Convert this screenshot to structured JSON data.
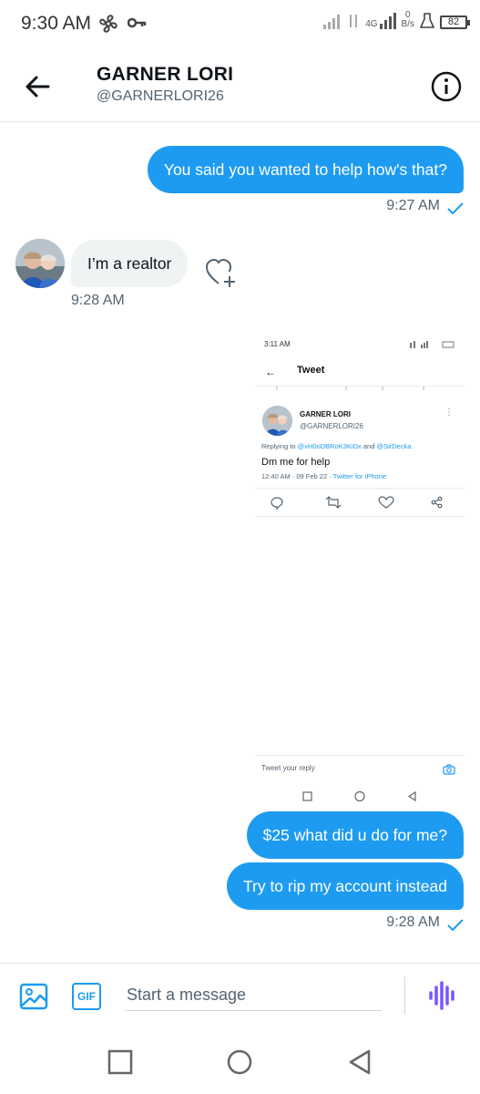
{
  "status_bar": {
    "time": "9:30 AM",
    "network": "4G",
    "speed_value": "0",
    "speed_unit": "B/s",
    "battery": "82",
    "icons": [
      "fan-icon",
      "key-icon",
      "signal-icon",
      "battery-icon"
    ]
  },
  "header": {
    "name": "GARNER LORI",
    "handle": "@GARNERLORI26",
    "icons": [
      "back-arrow-icon",
      "info-icon"
    ]
  },
  "messages": [
    {
      "direction": "out",
      "text": "You said you wanted to help how's that?",
      "time": "9:27 AM"
    },
    {
      "direction": "in",
      "text": "I’m a realtor",
      "time": "9:28 AM"
    },
    {
      "direction": "out",
      "type": "image",
      "description": "embedded-tweet-screenshot"
    },
    {
      "direction": "out",
      "text": "$25 what did u do for me?"
    },
    {
      "direction": "out",
      "text": "Try to rip my account instead",
      "time": "9:28 AM"
    }
  ],
  "embedded_screenshot": {
    "status_time": "3:11 AM",
    "title": "Tweet",
    "name": "GARNER LORI",
    "handle": "@GARNERLORI26",
    "replying_prefix": "Replying to",
    "replying_user1": "@xH0oDBRoK3KiDx",
    "replying_and": "and",
    "replying_user2": "@SirDecka",
    "tweet_text": "Dm me for help",
    "meta_time": "12:40 AM · 09 Feb 22 ·",
    "meta_source": "Twitter for iPhone",
    "compose_placeholder": "Tweet your reply"
  },
  "composer": {
    "placeholder": "Start a message",
    "gif_label": "GIF",
    "icons": [
      "image-icon",
      "gif-icon",
      "voice-icon"
    ]
  },
  "colors": {
    "accent": "#1d9bf0",
    "voice": "#7856ff",
    "incoming_bubble": "#eff3f4",
    "muted_text": "#536471"
  }
}
